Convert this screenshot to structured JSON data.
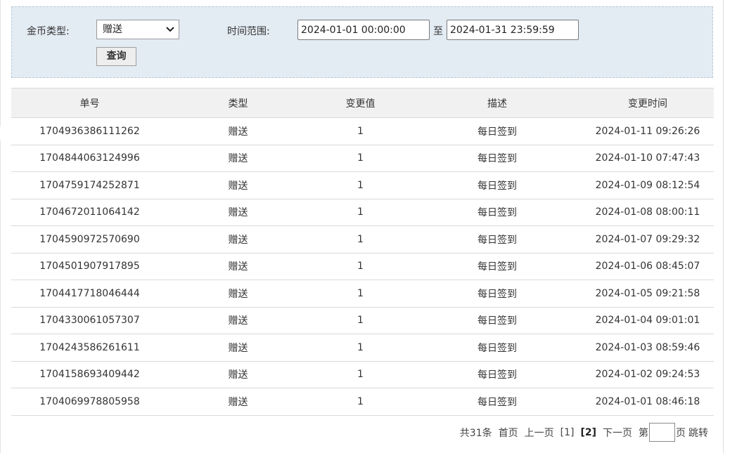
{
  "filter": {
    "coin_type_label": "金币类型:",
    "coin_type_value": "赠送",
    "time_range_label": "时间范围:",
    "start_time": "2024-01-01 00:00:00",
    "to_label": "至",
    "end_time": "2024-01-31 23:59:59",
    "query_button": "查询"
  },
  "table": {
    "headers": [
      "单号",
      "类型",
      "变更值",
      "描述",
      "变更时间"
    ],
    "rows": [
      [
        "1704936386111262",
        "赠送",
        "1",
        "每日签到",
        "2024-01-11 09:26:26"
      ],
      [
        "1704844063124996",
        "赠送",
        "1",
        "每日签到",
        "2024-01-10 07:47:43"
      ],
      [
        "1704759174252871",
        "赠送",
        "1",
        "每日签到",
        "2024-01-09 08:12:54"
      ],
      [
        "1704672011064142",
        "赠送",
        "1",
        "每日签到",
        "2024-01-08 08:00:11"
      ],
      [
        "1704590972570690",
        "赠送",
        "1",
        "每日签到",
        "2024-01-07 09:29:32"
      ],
      [
        "1704501907917895",
        "赠送",
        "1",
        "每日签到",
        "2024-01-06 08:45:07"
      ],
      [
        "1704417718046444",
        "赠送",
        "1",
        "每日签到",
        "2024-01-05 09:21:58"
      ],
      [
        "1704330061057307",
        "赠送",
        "1",
        "每日签到",
        "2024-01-04 09:01:01"
      ],
      [
        "1704243586261611",
        "赠送",
        "1",
        "每日签到",
        "2024-01-03 08:59:46"
      ],
      [
        "1704158693409442",
        "赠送",
        "1",
        "每日签到",
        "2024-01-02 09:24:53"
      ],
      [
        "1704069978805958",
        "赠送",
        "1",
        "每日签到",
        "2024-01-01 08:46:18"
      ]
    ]
  },
  "pager": {
    "total": "共31条",
    "first": "首页",
    "prev": "上一页",
    "page1": "[1]",
    "page2": "[2]",
    "next": "下一页",
    "goto_prefix": "第",
    "goto_suffix": "页",
    "jump": "跳转"
  }
}
